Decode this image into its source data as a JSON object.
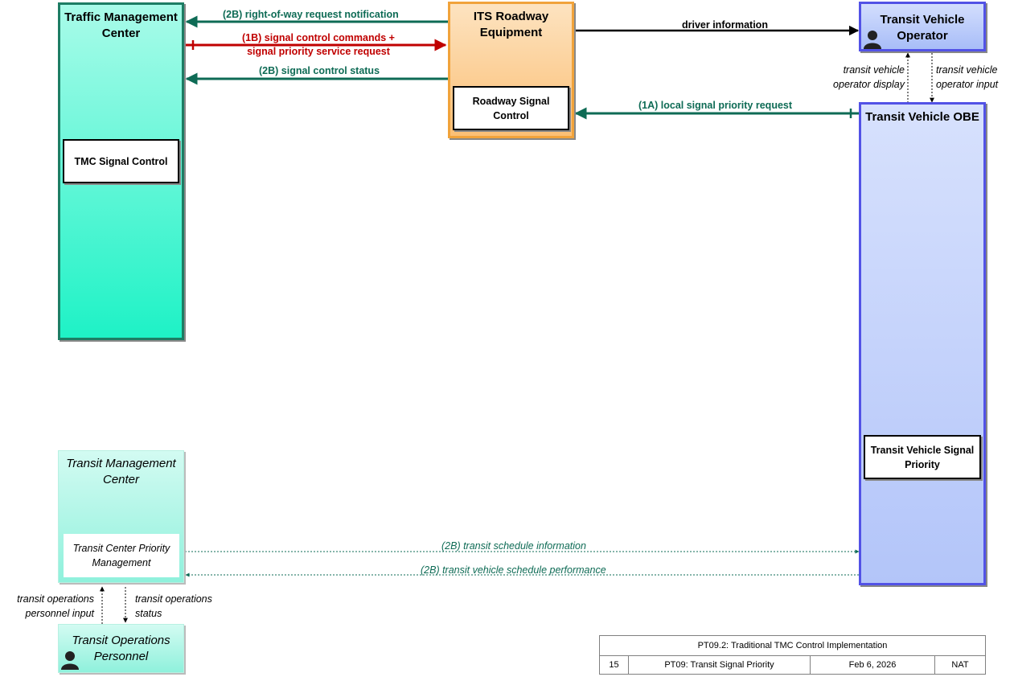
{
  "nodes": {
    "tmc": {
      "title": "Traffic Management Center",
      "sub": "TMC Signal Control"
    },
    "roadway": {
      "title": "ITS Roadway Equipment",
      "sub": "Roadway Signal Control"
    },
    "operator": {
      "title": "Transit Vehicle Operator"
    },
    "obe": {
      "title": "Transit Vehicle OBE",
      "sub": "Transit Vehicle Signal Priority"
    },
    "transit_mc": {
      "title": "Transit Management Center",
      "sub": "Transit Center Priority Management"
    },
    "personnel": {
      "title": "Transit Operations Personnel"
    }
  },
  "flows": {
    "row_notification": "(2B) right-of-way request notification",
    "signal_commands_1": "(1B) signal control commands +",
    "signal_commands_2": "signal priority service request",
    "signal_status": "(2B) signal control status",
    "driver_info": "driver information",
    "local_priority": "(1A) local signal priority request",
    "op_display_1": "transit vehicle",
    "op_display_2": "operator display",
    "op_input_1": "transit vehicle",
    "op_input_2": "operator input",
    "schedule_info": "(2B) transit schedule information",
    "schedule_perf": "(2B) transit vehicle schedule performance",
    "personnel_input_1": "transit operations",
    "personnel_input_2": "personnel input",
    "ops_status_1": "transit operations",
    "ops_status_2": "status"
  },
  "footer": {
    "title": "PT09.2: Traditional TMC Control Implementation",
    "number": "15",
    "package": "PT09: Transit Signal Priority",
    "date": "Feb 6, 2026",
    "scope": "NAT"
  },
  "colors": {
    "green_flow": "#0e6b55",
    "red_flow": "#c00000",
    "tmc_fill": "#1ef2c6",
    "roadway_fill": "#fbbf75",
    "obe_fill": "#b7c8f9",
    "obe_border": "#5252e6"
  }
}
